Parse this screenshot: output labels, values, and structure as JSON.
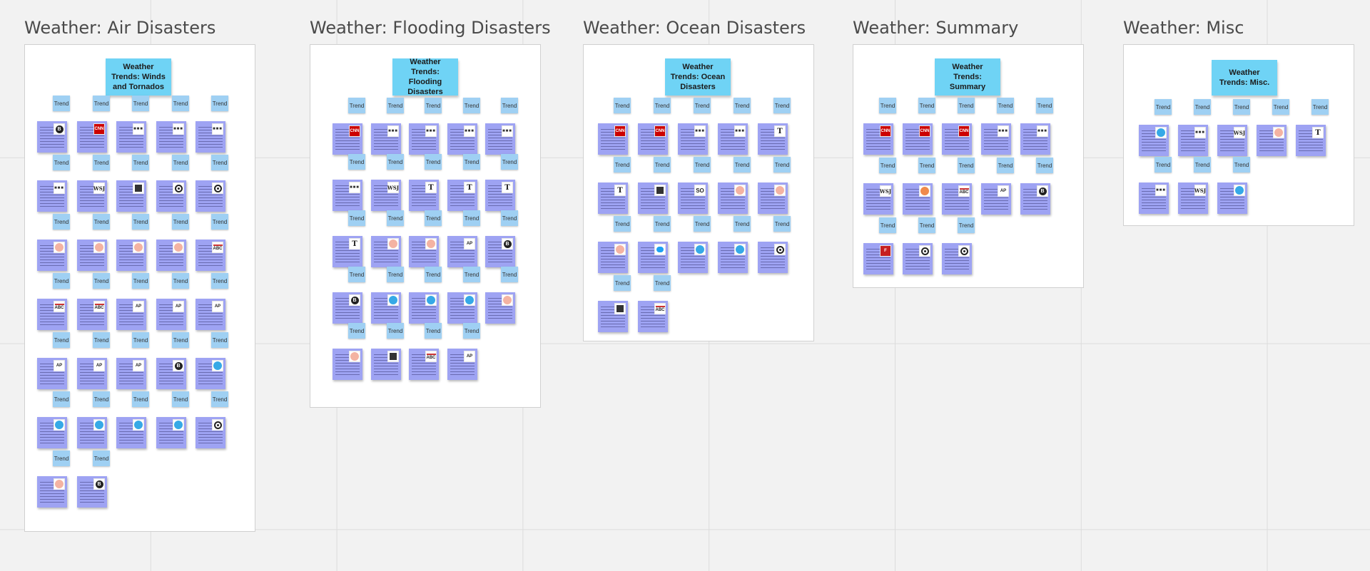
{
  "frames": [
    {
      "title": "Weather: Air Disasters",
      "header": "Weather Trends: Winds and Tornados",
      "trend_label": "Trend",
      "cards": [
        {
          "logo": "b"
        },
        {
          "logo": "cnn",
          "text": "CNN"
        },
        {
          "logo": "nbc",
          "text": "■■■"
        },
        {
          "logo": "nbc",
          "text": "■■■"
        },
        {
          "logo": "nbc",
          "text": "■■■"
        },
        {
          "logo": "nbc",
          "text": "■■■"
        },
        {
          "logo": "wsj",
          "text": "WSJ"
        },
        {
          "logo": "sq"
        },
        {
          "logo": "cbs"
        },
        {
          "logo": "cbs"
        },
        {
          "logo": "pink"
        },
        {
          "logo": "pink"
        },
        {
          "logo": "pink"
        },
        {
          "logo": "pink"
        },
        {
          "logo": "abc",
          "text": "ABC"
        },
        {
          "logo": "abc",
          "text": "ABC"
        },
        {
          "logo": "abc",
          "text": "ABC"
        },
        {
          "logo": "ap",
          "text": "AP"
        },
        {
          "logo": "ap",
          "text": "AP"
        },
        {
          "logo": "ap",
          "text": "AP"
        },
        {
          "logo": "ap",
          "text": "AP"
        },
        {
          "logo": "ap",
          "text": "AP"
        },
        {
          "logo": "ap",
          "text": "AP"
        },
        {
          "logo": "b"
        },
        {
          "logo": "wave"
        },
        {
          "logo": "wave"
        },
        {
          "logo": "wave"
        },
        {
          "logo": "wave"
        },
        {
          "logo": "wave"
        },
        {
          "logo": "cbs"
        },
        {
          "logo": "pink"
        },
        {
          "logo": "b"
        }
      ]
    },
    {
      "title": "Weather: Flooding Disasters",
      "header": "Weather Trends: Flooding Disasters",
      "trend_label": "Trend",
      "cards": [
        {
          "logo": "cnn",
          "text": "CNN"
        },
        {
          "logo": "nbc",
          "text": "■■■"
        },
        {
          "logo": "nbc",
          "text": "■■■"
        },
        {
          "logo": "nbc",
          "text": "■■■"
        },
        {
          "logo": "nbc",
          "text": "■■■"
        },
        {
          "logo": "nbc",
          "text": "■■■"
        },
        {
          "logo": "wsj",
          "text": "WSJ"
        },
        {
          "logo": "nyt",
          "text": "T"
        },
        {
          "logo": "nyt",
          "text": "T"
        },
        {
          "logo": "nyt",
          "text": "T"
        },
        {
          "logo": "nyt",
          "text": "T"
        },
        {
          "logo": "pink"
        },
        {
          "logo": "pink"
        },
        {
          "logo": "ap",
          "text": "AP"
        },
        {
          "logo": "b"
        },
        {
          "logo": "b"
        },
        {
          "logo": "wave"
        },
        {
          "logo": "wave"
        },
        {
          "logo": "wave"
        },
        {
          "logo": "pink"
        },
        {
          "logo": "pink"
        },
        {
          "logo": "sq"
        },
        {
          "logo": "abc",
          "text": "ABC"
        },
        {
          "logo": "ap",
          "text": "AP"
        }
      ]
    },
    {
      "title": "Weather: Ocean Disasters",
      "header": "Weather Trends: Ocean Disasters",
      "trend_label": "Trend",
      "cards": [
        {
          "logo": "cnn",
          "text": "CNN"
        },
        {
          "logo": "cnn",
          "text": "CNN"
        },
        {
          "logo": "nbc",
          "text": "■■■"
        },
        {
          "logo": "nbc",
          "text": "■■■"
        },
        {
          "logo": "nyt",
          "text": "T"
        },
        {
          "logo": "nyt",
          "text": "T"
        },
        {
          "logo": "sq"
        },
        {
          "logo": "so",
          "text": "SO"
        },
        {
          "logo": "pink"
        },
        {
          "logo": "pink"
        },
        {
          "logo": "pink"
        },
        {
          "logo": "tw"
        },
        {
          "logo": "wave"
        },
        {
          "logo": "wave"
        },
        {
          "logo": "cbs"
        },
        {
          "logo": "sq"
        },
        {
          "logo": "abc",
          "text": "ABC"
        }
      ]
    },
    {
      "title": "Weather: Summary",
      "header": "Weather Trends: Summary",
      "trend_label": "Trend",
      "cards": [
        {
          "logo": "cnn",
          "text": "CNN"
        },
        {
          "logo": "cnn",
          "text": "CNN"
        },
        {
          "logo": "cnn",
          "text": "CNN"
        },
        {
          "logo": "nbc",
          "text": "■■■"
        },
        {
          "logo": "nbc",
          "text": "■■■"
        },
        {
          "logo": "wsj",
          "text": "WSJ"
        },
        {
          "logo": "orange"
        },
        {
          "logo": "abc",
          "text": "ABC"
        },
        {
          "logo": "ap",
          "text": "AP"
        },
        {
          "logo": "b"
        },
        {
          "logo": "fox",
          "text": "F"
        },
        {
          "logo": "cbs"
        },
        {
          "logo": "cbs"
        }
      ]
    },
    {
      "title": "Weather: Misc",
      "header": "Weather Trends: Misc.",
      "trend_label": "Trend",
      "cards": [
        {
          "logo": "wave"
        },
        {
          "logo": "nbc",
          "text": "■■■"
        },
        {
          "logo": "wsj",
          "text": "WSJ"
        },
        {
          "logo": "pink"
        },
        {
          "logo": "nyt",
          "text": "T"
        },
        {
          "logo": "nbc",
          "text": "■■■"
        },
        {
          "logo": "wsj",
          "text": "WSJ"
        },
        {
          "logo": "wave"
        }
      ]
    }
  ]
}
